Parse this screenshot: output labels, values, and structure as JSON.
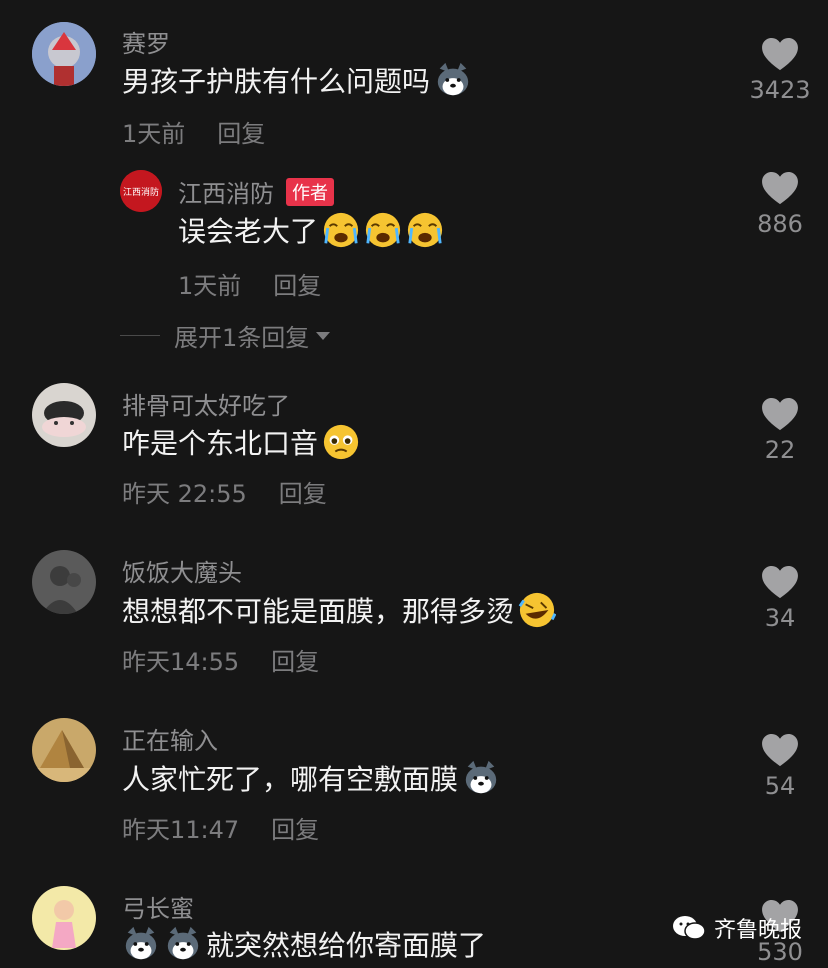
{
  "comments": [
    {
      "username": "赛罗",
      "text": "男孩子护肤有什么问题吗",
      "time": "1天前",
      "reply": "回复",
      "likes": "3423",
      "emojis": [
        "husky-emoji"
      ]
    },
    {
      "username": "江西消防",
      "badge": "作者",
      "avatar_text": "江西消防",
      "text": "误会老大了",
      "time": "1天前",
      "reply": "回复",
      "likes": "886",
      "emojis": [
        "crying-emoji",
        "crying-emoji",
        "crying-emoji"
      ]
    },
    {
      "username": "排骨可太好吃了",
      "text": "咋是个东北口音",
      "time": "昨天 22:55",
      "reply": "回复",
      "likes": "22",
      "emojis": [
        "pleading-emoji"
      ]
    },
    {
      "username": "饭饭大魔头",
      "text": "想想都不可能是面膜，那得多烫",
      "time": "昨天14:55",
      "reply": "回复",
      "likes": "34",
      "emojis": [
        "rofl-emoji"
      ]
    },
    {
      "username": "正在输入",
      "text": "人家忙死了，哪有空敷面膜",
      "time": "昨天11:47",
      "reply": "回复",
      "likes": "54",
      "emojis": [
        "husky-emoji"
      ]
    },
    {
      "username": "弓长蜜",
      "text": "就突然想给你寄面膜了",
      "likes": "530",
      "emojis_before": [
        "husky-emoji",
        "husky-emoji"
      ]
    }
  ],
  "expand_replies": "展开1条回复",
  "watermark": "齐鲁晚报",
  "colors": {
    "background": "#161616",
    "badge": "#e8334a",
    "text": "#f2f2f2",
    "muted": "#8f8f91"
  }
}
